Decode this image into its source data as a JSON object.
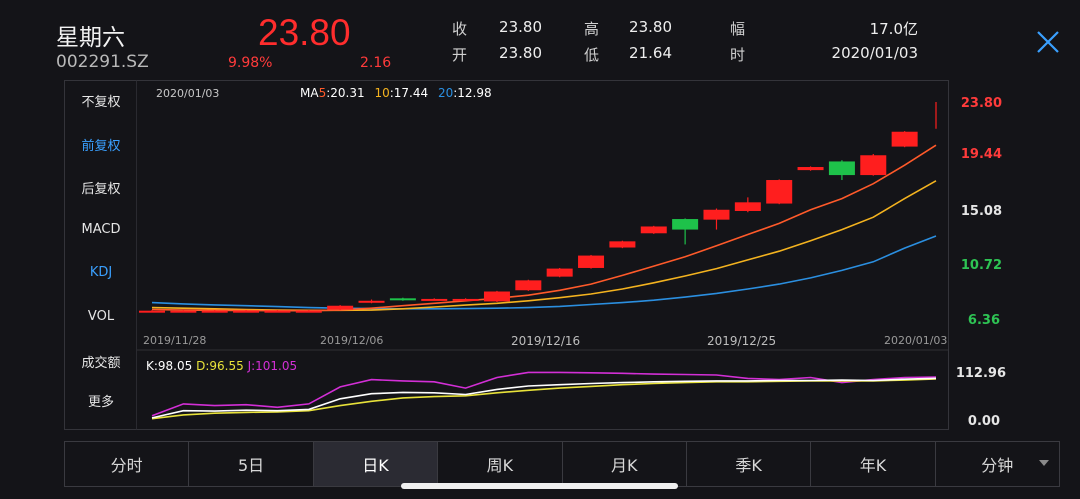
{
  "header": {
    "stock_name": "星期六",
    "stock_code": "002291.SZ",
    "last_price": "23.80",
    "change_pct": "9.98%",
    "change_val": "2.16",
    "stats": {
      "close_label": "收",
      "close_value": "23.80",
      "high_label": "高",
      "high_value": "23.80",
      "amp_label": "幅",
      "amp_value": "17.0亿",
      "open_label": "开",
      "open_value": "23.80",
      "low_label": "低",
      "low_value": "21.64",
      "time_label": "时",
      "time_value": "2020/01/03"
    }
  },
  "left_menu": [
    "不复权",
    "前复权",
    "后复权",
    "MACD",
    "KDJ",
    "VOL",
    "成交额",
    "更多"
  ],
  "left_menu_active": [
    "前复权",
    "KDJ"
  ],
  "chart": {
    "selected_date": "2020/01/03",
    "ma_legend": {
      "prefix": "MA",
      "ma5_key": "5",
      "ma5_val": ":20.31",
      "ma10_key": "10",
      "ma10_val": ":17.44",
      "ma20_key": "20",
      "ma20_val": ":12.98"
    },
    "price_axis": [
      "23.80",
      "19.44",
      "15.08",
      "10.72",
      "6.36"
    ],
    "date_ticks": [
      "2019/11/28",
      "2019/12/06",
      "2019/12/16",
      "2019/12/25",
      "2020/01/03"
    ],
    "kdj_legend": {
      "k": "K:98.05",
      "d": "D:96.55",
      "j": "J:101.05"
    },
    "kdj_axis": [
      "112.96",
      "0.00"
    ]
  },
  "chart_data": {
    "type": "candlestick",
    "price_range": [
      6.36,
      23.8
    ],
    "candles": [
      {
        "o": 6.9,
        "c": 6.95,
        "h": 7.0,
        "l": 6.85
      },
      {
        "o": 6.95,
        "c": 6.95,
        "h": 7.0,
        "l": 6.9
      },
      {
        "o": 6.95,
        "c": 6.95,
        "h": 7.0,
        "l": 6.9
      },
      {
        "o": 6.95,
        "c": 6.95,
        "h": 7.0,
        "l": 6.9
      },
      {
        "o": 6.95,
        "c": 6.95,
        "h": 7.0,
        "l": 6.9
      },
      {
        "o": 6.95,
        "c": 6.95,
        "h": 7.0,
        "l": 6.9
      },
      {
        "o": 7.05,
        "c": 7.35,
        "h": 7.4,
        "l": 7.0
      },
      {
        "o": 7.6,
        "c": 7.75,
        "h": 7.85,
        "l": 7.55
      },
      {
        "o": 7.95,
        "c": 7.8,
        "h": 8.0,
        "l": 7.75
      },
      {
        "o": 7.9,
        "c": 7.9,
        "h": 7.95,
        "l": 7.85
      },
      {
        "o": 7.9,
        "c": 7.9,
        "h": 7.95,
        "l": 7.85
      },
      {
        "o": 7.7,
        "c": 8.5,
        "h": 8.55,
        "l": 7.65
      },
      {
        "o": 8.6,
        "c": 9.4,
        "h": 9.45,
        "l": 8.55
      },
      {
        "o": 9.7,
        "c": 10.35,
        "h": 10.4,
        "l": 9.65
      },
      {
        "o": 10.4,
        "c": 11.4,
        "h": 11.45,
        "l": 10.35
      },
      {
        "o": 12.05,
        "c": 12.55,
        "h": 12.6,
        "l": 12.0
      },
      {
        "o": 13.2,
        "c": 13.75,
        "h": 13.8,
        "l": 13.15
      },
      {
        "o": 14.35,
        "c": 13.5,
        "h": 14.4,
        "l": 12.3
      },
      {
        "o": 14.3,
        "c": 15.1,
        "h": 15.2,
        "l": 13.5
      },
      {
        "o": 15.0,
        "c": 15.7,
        "h": 16.1,
        "l": 14.9
      },
      {
        "o": 15.6,
        "c": 17.5,
        "h": 17.55,
        "l": 15.55
      },
      {
        "o": 18.3,
        "c": 18.55,
        "h": 18.6,
        "l": 18.25
      },
      {
        "o": 19.0,
        "c": 17.9,
        "h": 19.1,
        "l": 17.5
      },
      {
        "o": 17.9,
        "c": 19.5,
        "h": 19.6,
        "l": 17.85
      },
      {
        "o": 20.2,
        "c": 21.4,
        "h": 21.45,
        "l": 20.15
      },
      {
        "o": 23.8,
        "c": 23.8,
        "h": 23.8,
        "l": 21.64
      }
    ],
    "ma5": [
      7.05,
      7.0,
      6.98,
      6.96,
      6.95,
      6.95,
      7.0,
      7.15,
      7.35,
      7.55,
      7.75,
      7.95,
      8.2,
      8.6,
      9.1,
      9.8,
      10.55,
      11.3,
      12.2,
      13.1,
      14.0,
      15.1,
      16.0,
      17.2,
      18.7,
      20.31
    ],
    "ma10": [
      7.2,
      7.15,
      7.1,
      7.05,
      7.0,
      6.98,
      6.98,
      7.0,
      7.1,
      7.25,
      7.4,
      7.55,
      7.75,
      8.0,
      8.3,
      8.7,
      9.2,
      9.75,
      10.35,
      11.05,
      11.75,
      12.6,
      13.5,
      14.5,
      16.0,
      17.44
    ],
    "ma20": [
      7.6,
      7.5,
      7.42,
      7.35,
      7.28,
      7.2,
      7.15,
      7.12,
      7.1,
      7.1,
      7.12,
      7.15,
      7.2,
      7.3,
      7.45,
      7.6,
      7.8,
      8.05,
      8.35,
      8.7,
      9.1,
      9.6,
      10.2,
      10.9,
      12.0,
      12.98
    ],
    "kdj_range": [
      0,
      112.96
    ],
    "k": [
      5,
      22,
      21,
      23,
      22,
      25,
      50,
      62,
      65,
      64,
      60,
      72,
      80,
      83,
      86,
      88,
      90,
      91,
      92,
      92,
      93,
      93,
      94,
      93,
      96,
      98.05
    ],
    "d": [
      3,
      12,
      16,
      18,
      19,
      22,
      34,
      44,
      52,
      55,
      57,
      64,
      70,
      75,
      79,
      83,
      86,
      88,
      90,
      90,
      91,
      92,
      92,
      92,
      94,
      96.55
    ],
    "j": [
      10,
      38,
      34,
      36,
      30,
      38,
      78,
      95,
      92,
      90,
      75,
      100,
      112,
      112,
      111,
      110,
      108,
      107,
      106,
      98,
      95,
      100,
      88,
      95,
      100,
      101.05
    ],
    "colors": {
      "up": "#ff1e1e",
      "down": "#1ec24a",
      "ma5": "#ff5a2a",
      "ma10": "#f4b31f",
      "ma20": "#2b8fe0",
      "k": "#ffffff",
      "d": "#e8e23a",
      "j": "#d32fd6"
    }
  },
  "tabs": [
    "分时",
    "5日",
    "日K",
    "周K",
    "月K",
    "季K",
    "年K",
    "分钟"
  ],
  "tab_active": "日K"
}
